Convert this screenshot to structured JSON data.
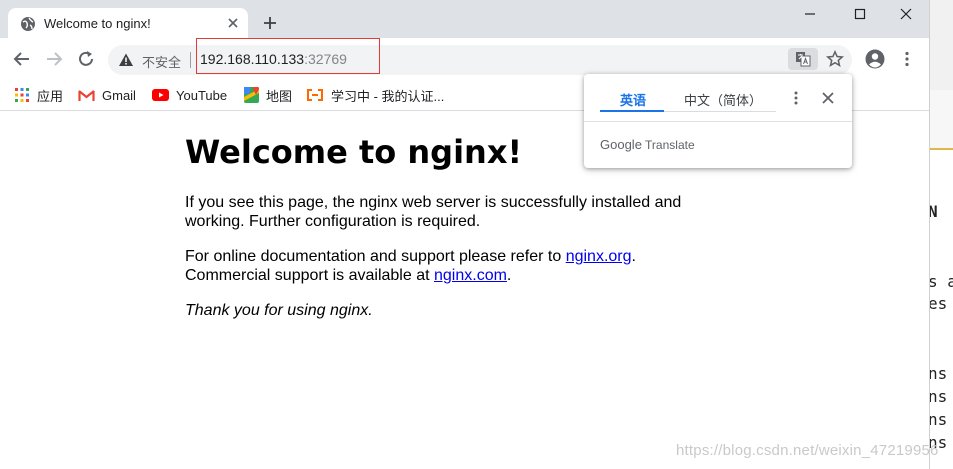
{
  "tab": {
    "title": "Welcome to nginx!"
  },
  "omnibox": {
    "security_label": "不安全",
    "url_host": "192.168.110.133",
    "url_port": ":32769"
  },
  "bookmarks": [
    {
      "label": "应用",
      "icon": "apps-grid-icon"
    },
    {
      "label": "Gmail",
      "icon": "gmail-icon"
    },
    {
      "label": "YouTube",
      "icon": "youtube-icon"
    },
    {
      "label": "地图",
      "icon": "maps-icon"
    },
    {
      "label": "学习中 - 我的认证...",
      "icon": "bookmark-site-icon"
    }
  ],
  "page": {
    "heading": "Welcome to nginx!",
    "p1_line1": "If you see this page, the nginx web server is successfully installed and",
    "p1_line2": "working. Further configuration is required.",
    "p2_line1_pre": "For online documentation and support please refer to ",
    "p2_link1": "nginx.org",
    "p2_line1_post": ".",
    "p2_line2_pre": "Commercial support is available at ",
    "p2_link2": "nginx.com",
    "p2_line2_post": ".",
    "p3": "Thank you for using nginx."
  },
  "translate_popup": {
    "source_lang": "英语",
    "target_lang": "中文（简体）",
    "branding_google": "Google",
    "branding_translate": "Translate"
  },
  "side_fragments": [
    "N",
    "s  a",
    "es",
    "ns",
    "ns",
    "ns",
    "ns"
  ],
  "watermark": "https://blog.csdn.net/weixin_47219956",
  "colors": {
    "accent": "#1a73e8",
    "link": "#0000ee",
    "highlight_box": "#e53935"
  }
}
